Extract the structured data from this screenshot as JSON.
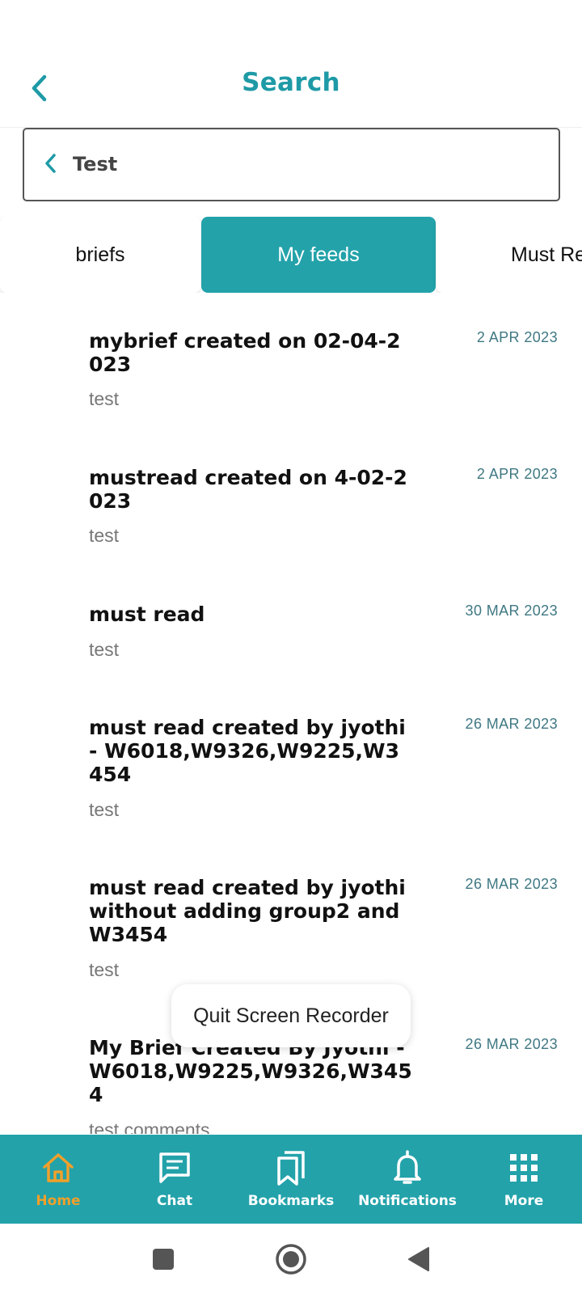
{
  "header": {
    "title": "Search"
  },
  "search": {
    "value": "Test"
  },
  "tabs": [
    {
      "label": "briefs",
      "active": false
    },
    {
      "label": "My feeds",
      "active": true
    },
    {
      "label": "Must Re",
      "active": false
    }
  ],
  "feeds": [
    {
      "title": "mybrief created on 02-04-2023",
      "date": "2 APR 2023",
      "subtitle": "test"
    },
    {
      "title": "mustread created on 4-02-2023",
      "date": "2 APR 2023",
      "subtitle": "test"
    },
    {
      "title": "must read",
      "date": "30 MAR 2023",
      "subtitle": "test"
    },
    {
      "title": "must read created by jyothi - W6018,W9326,W9225,W3454",
      "date": "26 MAR 2023",
      "subtitle": "test"
    },
    {
      "title": "must read created by jyothi without adding group2 and W3454",
      "date": "26 MAR 2023",
      "subtitle": "test"
    },
    {
      "title": "My Brief Created By Jyothi - W6018,W9225,W9326,W3454",
      "date": "26 MAR 2023",
      "subtitle": "test comments"
    }
  ],
  "toast": {
    "label": "Quit Screen Recorder"
  },
  "nav": [
    {
      "label": "Home",
      "icon": "home-icon",
      "active": true
    },
    {
      "label": "Chat",
      "icon": "chat-icon",
      "active": false
    },
    {
      "label": "Bookmarks",
      "icon": "bookmarks-icon",
      "active": false
    },
    {
      "label": "Notifications",
      "icon": "bell-icon",
      "active": false
    },
    {
      "label": "More",
      "icon": "grid-icon",
      "active": false
    }
  ],
  "colors": {
    "accent": "#23a2aa",
    "title": "#1e9aa6",
    "active_nav": "#f0a02a",
    "date": "#3f7883"
  }
}
